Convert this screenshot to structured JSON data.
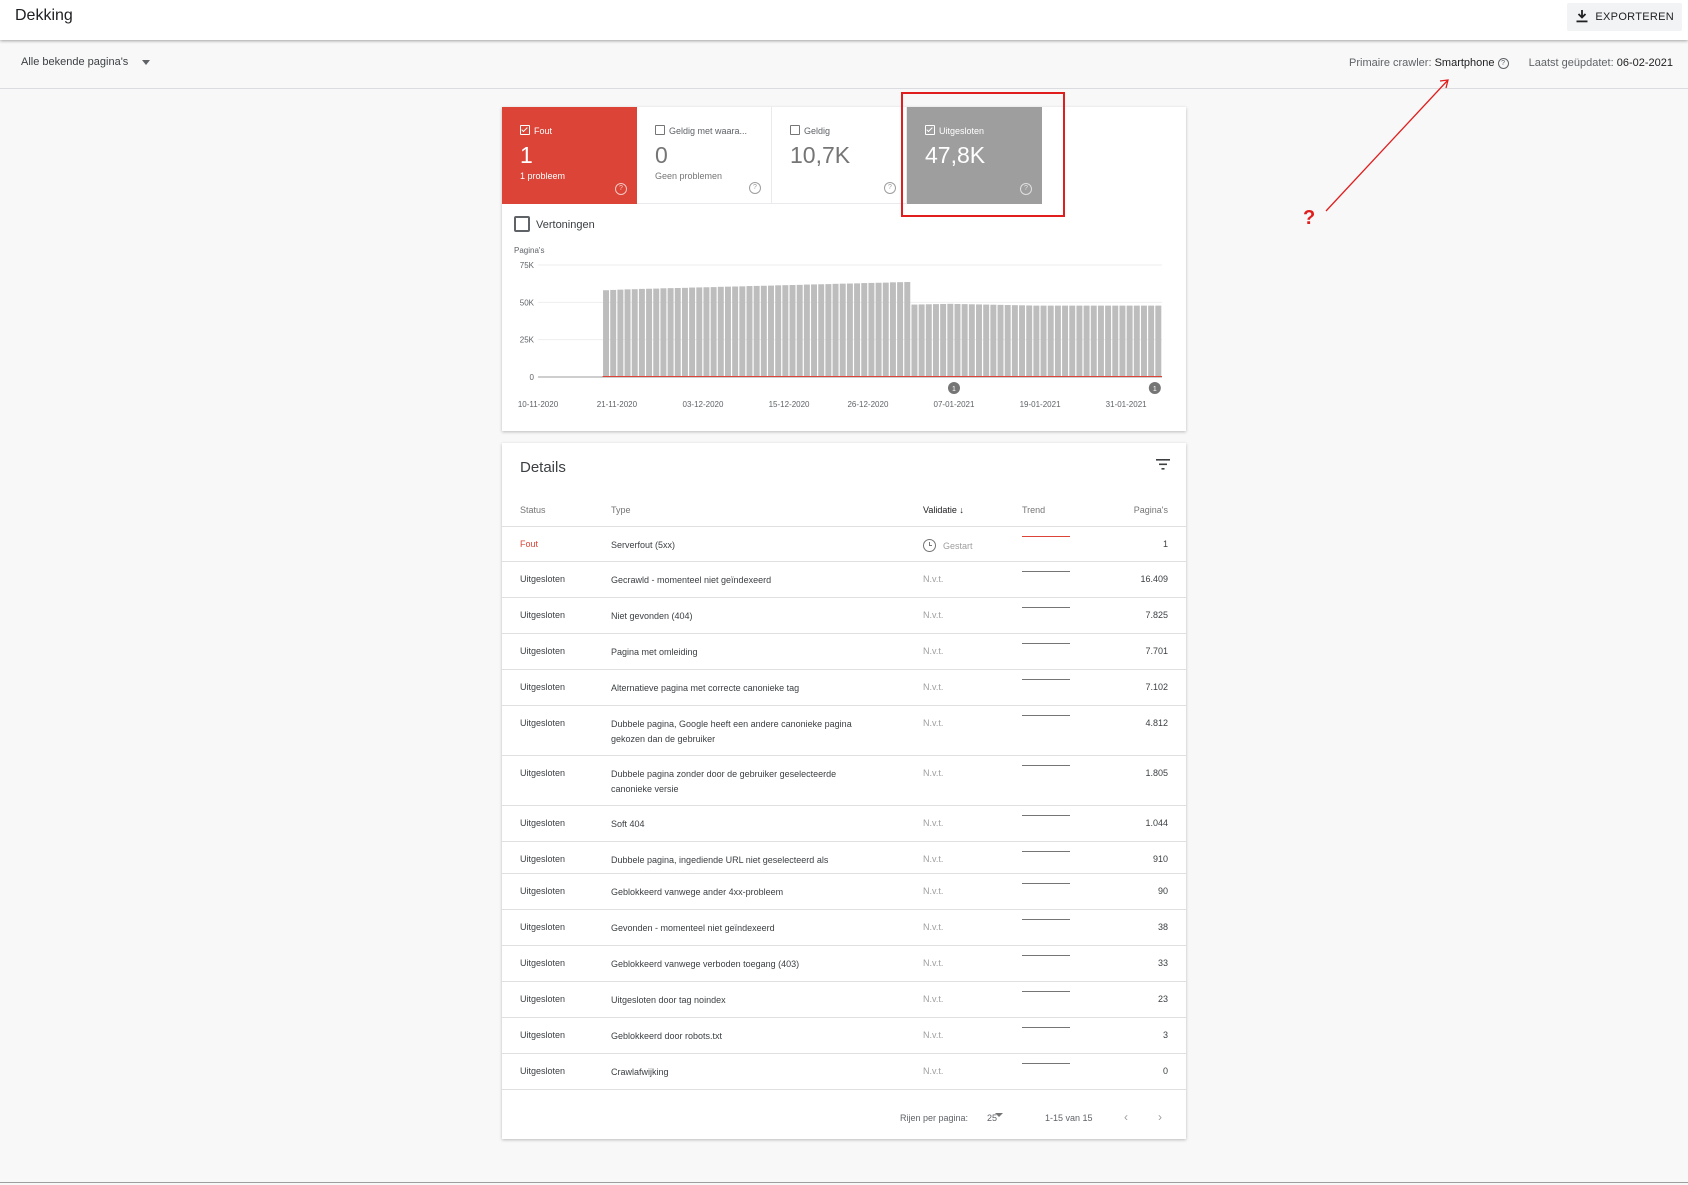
{
  "header": {
    "title": "Dekking",
    "export_label": "EXPORTEREN"
  },
  "filter": {
    "page_set": "Alle bekende pagina's",
    "crawler_label": "Primaire crawler:",
    "crawler_value": "Smartphone",
    "updated_label": "Laatst geüpdatet:",
    "updated_value": "06-02-2021"
  },
  "summary": {
    "tiles": [
      {
        "label": "Fout",
        "value": "1",
        "sub": "1 probleem",
        "checked": true
      },
      {
        "label": "Geldig met waara...",
        "value": "0",
        "sub": "Geen problemen",
        "checked": false
      },
      {
        "label": "Geldig",
        "value": "10,7K",
        "sub": "",
        "checked": false
      },
      {
        "label": "Uitgesloten",
        "value": "47,8K",
        "sub": "",
        "checked": true
      }
    ],
    "impressions_label": "Vertoningen",
    "help_glyph": "?"
  },
  "annotation": {
    "mark": "?"
  },
  "chart_data": {
    "type": "bar",
    "ylabel": "Pagina's",
    "yticks": [
      "75K",
      "50K",
      "25K",
      "0"
    ],
    "ylim": [
      0,
      75000
    ],
    "xticks": [
      "10-11-2020",
      "21-11-2020",
      "03-12-2020",
      "15-12-2020",
      "26-12-2020",
      "07-01-2021",
      "19-01-2021",
      "31-01-2021"
    ],
    "x_start": "10-11-2020",
    "x_end": "05-02-2021",
    "empty_until": "19-11-2020",
    "series": [
      {
        "name": "Uitgesloten",
        "color": "#bdbdbd",
        "values": [
          58100,
          58300,
          58500,
          58700,
          58800,
          59000,
          59100,
          59200,
          59400,
          59500,
          59600,
          59700,
          59900,
          60000,
          60100,
          60200,
          60400,
          60500,
          60600,
          60700,
          60900,
          61000,
          61100,
          61200,
          61400,
          61500,
          61600,
          61700,
          61900,
          62000,
          62100,
          62200,
          62400,
          62500,
          62600,
          62700,
          62900,
          63000,
          63100,
          63200,
          63400,
          63500,
          63600,
          48500,
          48600,
          48700,
          48800,
          48900,
          49000,
          48900,
          48800,
          48700,
          48600,
          48500,
          48400,
          48300,
          48200,
          48100,
          48000,
          47900,
          47800,
          47800,
          47800,
          47800,
          47800,
          47800,
          47800,
          47800,
          47800,
          47800,
          47800,
          47800,
          47800,
          47800,
          47800,
          47800,
          47800,
          47800
        ]
      },
      {
        "name": "Fout",
        "color": "#db4437",
        "values": [
          1
        ]
      }
    ],
    "annotations": [
      {
        "date": "07-01-2021",
        "label": "1"
      },
      {
        "date": "04-02-2021",
        "label": "1"
      }
    ]
  },
  "details": {
    "title": "Details",
    "columns": {
      "status": "Status",
      "type": "Type",
      "validation": "Validatie",
      "trend": "Trend",
      "pages": "Pagina's"
    },
    "rows": [
      {
        "status": "Fout",
        "type": "Serverfout (5xx)",
        "validation": "Gestart",
        "pages": "1"
      },
      {
        "status": "Uitgesloten",
        "type": "Gecrawld - momenteel niet geïndexeerd",
        "validation": "N.v.t.",
        "pages": "16.409"
      },
      {
        "status": "Uitgesloten",
        "type": "Niet gevonden (404)",
        "validation": "N.v.t.",
        "pages": "7.825"
      },
      {
        "status": "Uitgesloten",
        "type": "Pagina met omleiding",
        "validation": "N.v.t.",
        "pages": "7.701"
      },
      {
        "status": "Uitgesloten",
        "type": "Alternatieve pagina met correcte canonieke tag",
        "validation": "N.v.t.",
        "pages": "7.102"
      },
      {
        "status": "Uitgesloten",
        "type": "Dubbele pagina, Google heeft een andere canonieke pagina gekozen dan de gebruiker",
        "validation": "N.v.t.",
        "pages": "4.812"
      },
      {
        "status": "Uitgesloten",
        "type": "Dubbele pagina zonder door de gebruiker geselecteerde canonieke versie",
        "validation": "N.v.t.",
        "pages": "1.805"
      },
      {
        "status": "Uitgesloten",
        "type": "Soft 404",
        "validation": "N.v.t.",
        "pages": "1.044"
      },
      {
        "status": "Uitgesloten",
        "type": "Dubbele pagina, ingediende URL niet geselecteerd als",
        "validation": "N.v.t.",
        "pages": "910"
      },
      {
        "status": "Uitgesloten",
        "type": "Geblokkeerd vanwege ander 4xx-probleem",
        "validation": "N.v.t.",
        "pages": "90"
      },
      {
        "status": "Uitgesloten",
        "type": "Gevonden - momenteel niet geïndexeerd",
        "validation": "N.v.t.",
        "pages": "38"
      },
      {
        "status": "Uitgesloten",
        "type": "Geblokkeerd vanwege verboden toegang (403)",
        "validation": "N.v.t.",
        "pages": "33"
      },
      {
        "status": "Uitgesloten",
        "type": "Uitgesloten door tag noindex",
        "validation": "N.v.t.",
        "pages": "23"
      },
      {
        "status": "Uitgesloten",
        "type": "Geblokkeerd door robots.txt",
        "validation": "N.v.t.",
        "pages": "3"
      },
      {
        "status": "Uitgesloten",
        "type": "Crawlafwijking",
        "validation": "N.v.t.",
        "pages": "0"
      }
    ],
    "pager": {
      "rows_label": "Rijen per pagina:",
      "rows_value": "25",
      "range": "1-15 van 15",
      "prev": "‹",
      "next": "›"
    }
  }
}
